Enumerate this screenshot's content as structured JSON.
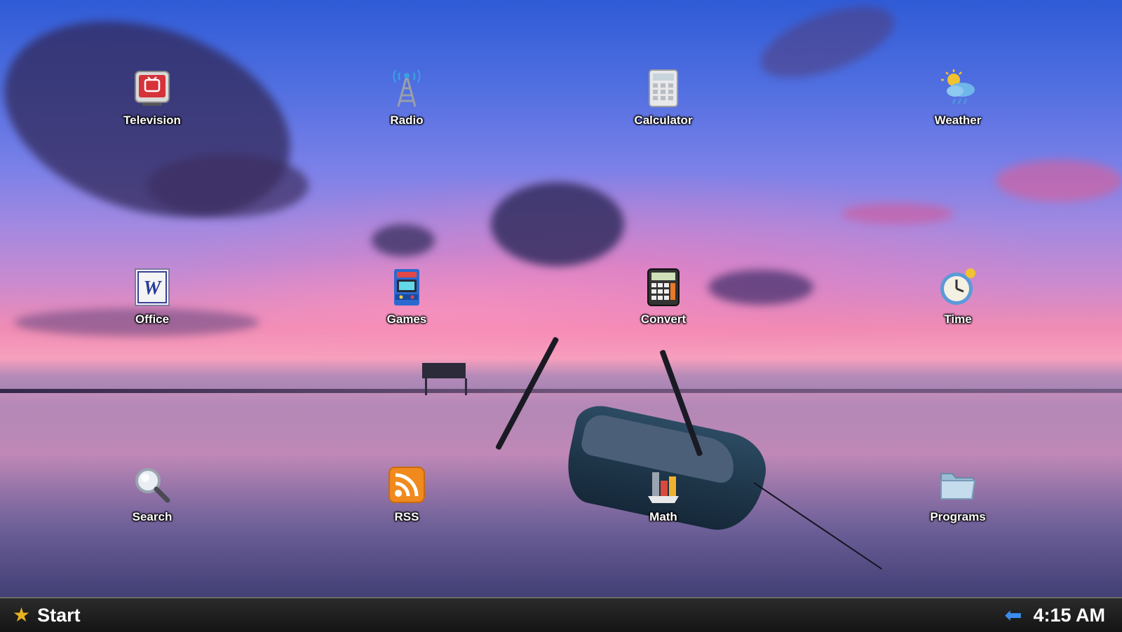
{
  "desktop": {
    "icons": [
      {
        "label": "Television",
        "icon": "television-icon"
      },
      {
        "label": "Radio",
        "icon": "radio-tower-icon"
      },
      {
        "label": "Calculator",
        "icon": "calculator-icon"
      },
      {
        "label": "Weather",
        "icon": "weather-icon"
      },
      {
        "label": "Office",
        "icon": "office-word-icon"
      },
      {
        "label": "Games",
        "icon": "arcade-games-icon"
      },
      {
        "label": "Convert",
        "icon": "convert-calculator-icon"
      },
      {
        "label": "Time",
        "icon": "clock-icon"
      },
      {
        "label": "Search",
        "icon": "magnifier-icon"
      },
      {
        "label": "RSS",
        "icon": "rss-icon"
      },
      {
        "label": "Math",
        "icon": "math-chart-icon"
      },
      {
        "label": "Programs",
        "icon": "folder-icon"
      }
    ]
  },
  "taskbar": {
    "start_label": "Start",
    "clock": "4:15 AM"
  },
  "colors": {
    "taskbar": "#1a1a1a",
    "start_star": "#e6b422",
    "back_arrow": "#3a8ef0"
  }
}
